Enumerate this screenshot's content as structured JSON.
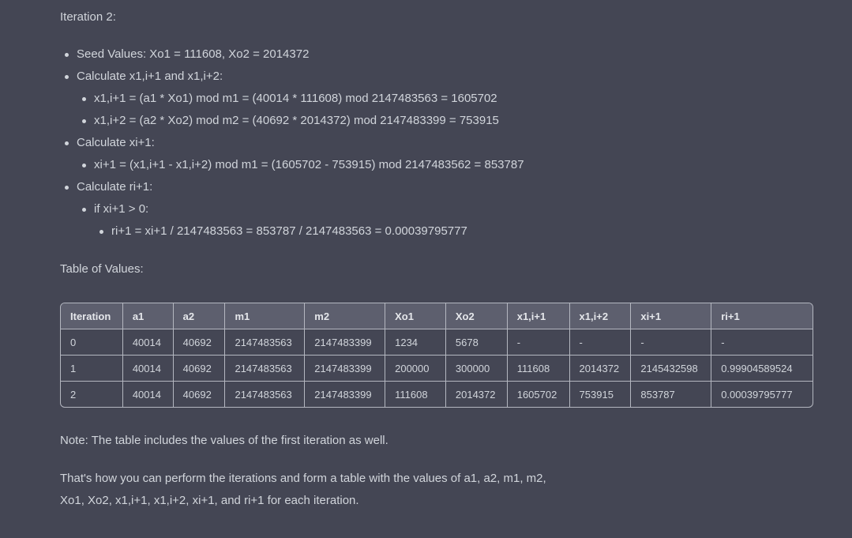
{
  "heading": "Iteration 2:",
  "bullets": {
    "seed": "Seed Values: Xo1 = 111608, Xo2 = 2014372",
    "calc_x": "Calculate x1,i+1 and x1,i+2:",
    "x1": "x1,i+1 = (a1 * Xo1) mod m1 = (40014 * 111608) mod 2147483563 = 1605702",
    "x2": "x1,i+2 = (a2 * Xo2) mod m2 = (40692 * 2014372) mod 2147483399 = 753915",
    "calc_xi": "Calculate xi+1:",
    "xi": "xi+1 = (x1,i+1 - x1,i+2) mod m1 = (1605702 - 753915) mod 2147483562 = 853787",
    "calc_ri": "Calculate ri+1:",
    "cond": "if xi+1 > 0:",
    "ri": "ri+1 = xi+1 / 2147483563 = 853787 / 2147483563 = 0.00039795777"
  },
  "table_title": "Table of Values:",
  "table": {
    "headers": [
      "Iteration",
      "a1",
      "a2",
      "m1",
      "m2",
      "Xo1",
      "Xo2",
      "x1,i+1",
      "x1,i+2",
      "xi+1",
      "ri+1"
    ],
    "rows": [
      [
        "0",
        "40014",
        "40692",
        "2147483563",
        "2147483399",
        "1234",
        "5678",
        "-",
        "-",
        "-",
        "-"
      ],
      [
        "1",
        "40014",
        "40692",
        "2147483563",
        "2147483399",
        "200000",
        "300000",
        "111608",
        "2014372",
        "2145432598",
        "0.99904589524"
      ],
      [
        "2",
        "40014",
        "40692",
        "2147483563",
        "2147483399",
        "111608",
        "2014372",
        "1605702",
        "753915",
        "853787",
        "0.00039795777"
      ]
    ]
  },
  "note": "Note: The table includes the values of the first iteration as well.",
  "closing": {
    "line1": "That's how you can perform the iterations and form a table with the values of a1, a2, m1, m2,",
    "line2": "Xo1, Xo2, x1,i+1, x1,i+2, xi+1, and ri+1 for each iteration."
  }
}
